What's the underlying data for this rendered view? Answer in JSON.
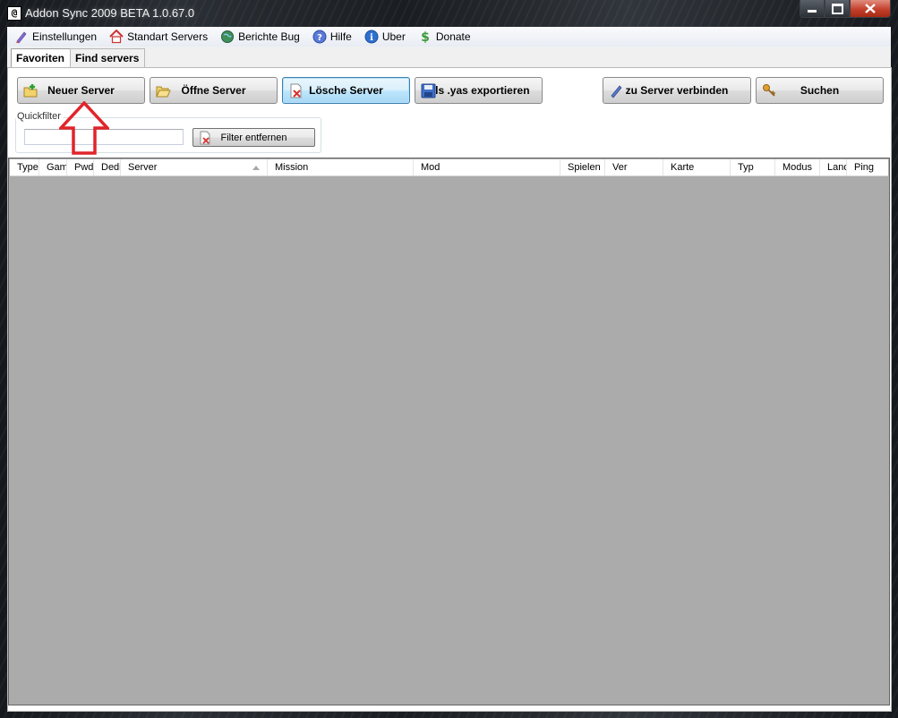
{
  "window": {
    "title": "Addon Sync 2009 BETA 1.0.67.0",
    "icon_glyph": "@",
    "controls": [
      "minimize",
      "maximize",
      "close"
    ]
  },
  "menubar": {
    "items": [
      {
        "label": "Einstellungen",
        "icon": "pencil-icon"
      },
      {
        "label": "Standart Servers",
        "icon": "home-icon"
      },
      {
        "label": "Berichte Bug",
        "icon": "globe-icon"
      },
      {
        "label": "Hilfe",
        "icon": "help-icon"
      },
      {
        "label": "Uber",
        "icon": "info-icon"
      },
      {
        "label": "Donate",
        "icon": "dollar-icon"
      }
    ]
  },
  "tabs": [
    {
      "label": "Favoriten",
      "active": true
    },
    {
      "label": "Find servers",
      "active": false
    }
  ],
  "toolbar": {
    "new_server": "Neuer Server",
    "open_server": "Öffne Server",
    "delete_server": "Lösche Server",
    "export_yas": "Als .yas exportieren",
    "connect": "zu Server verbinden",
    "search": "Suchen"
  },
  "quickfilter": {
    "label": "Quickfilter",
    "value": "",
    "clear_button": "Filter entfernen"
  },
  "grid": {
    "columns": [
      "Type",
      "Gam",
      "Pwd",
      "Dedi",
      "Server",
      "Mission",
      "Mod",
      "Spielen",
      "Ver",
      "Karte",
      "Typ",
      "Modus",
      "Land",
      "Ping"
    ],
    "sorted_column": "Server",
    "rows": []
  },
  "colors": {
    "annotation_arrow": "#e0252b",
    "grid_background": "#ababab"
  }
}
